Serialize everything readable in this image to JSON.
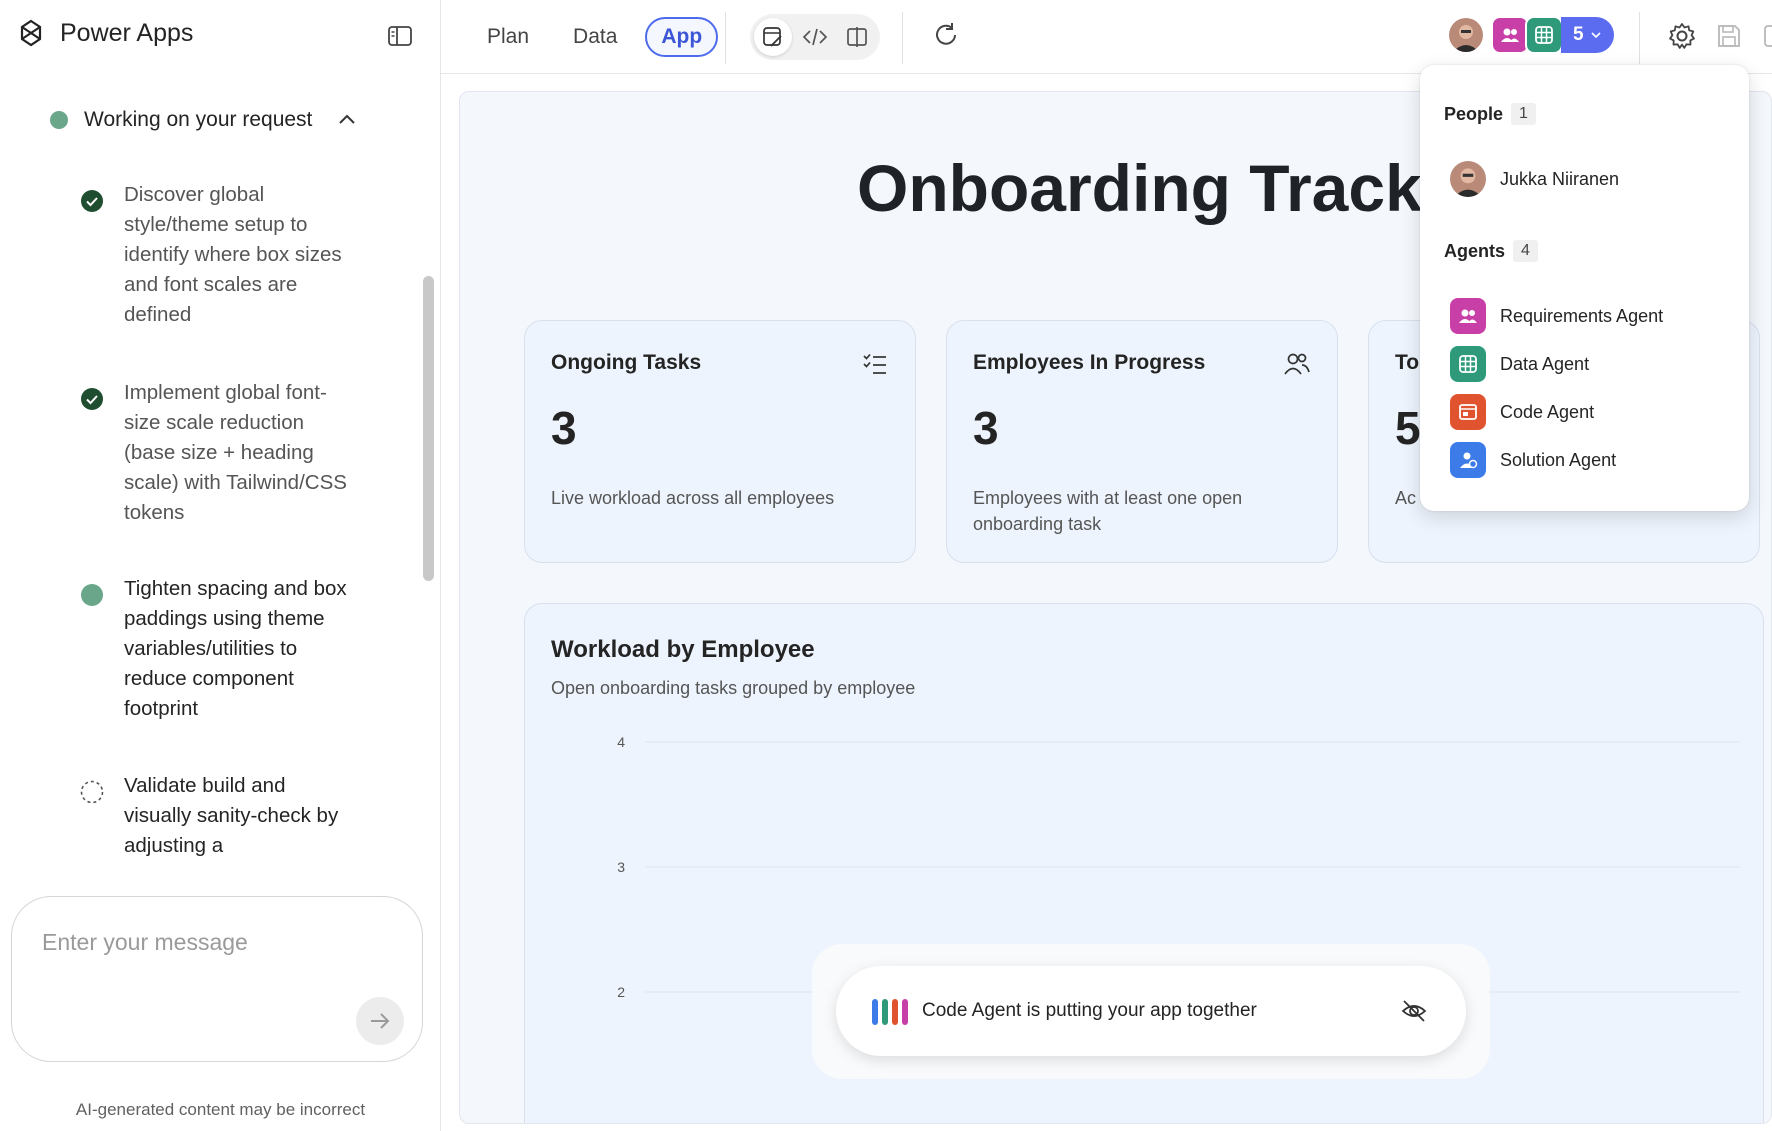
{
  "app": {
    "name": "Power Apps"
  },
  "left_panel": {
    "status_label": "Working on your request",
    "steps": [
      {
        "text": "Discover global style/theme setup to identify where box sizes and font scales are defined",
        "state": "done"
      },
      {
        "text": "Implement global font-size scale reduction (base size + heading scale) with Tailwind/CSS tokens",
        "state": "done"
      },
      {
        "text": "Tighten spacing and box paddings using theme variables/utilities to reduce component footprint",
        "state": "in-progress"
      },
      {
        "text": "Validate build and visually sanity-check by adjusting a",
        "state": "pending"
      }
    ],
    "composer_placeholder": "Enter your message",
    "disclaimer": "AI-generated content may be incorrect"
  },
  "topbar": {
    "tabs": [
      {
        "label": "Plan",
        "selected": false
      },
      {
        "label": "Data",
        "selected": false
      },
      {
        "label": "App",
        "selected": true
      }
    ],
    "collaborator_count": "5"
  },
  "canvas": {
    "title": "Onboarding Tracker",
    "cards": [
      {
        "title": "Ongoing Tasks",
        "value": "3",
        "description": "Live workload across all employees",
        "icon": "task-list-icon"
      },
      {
        "title": "Employees In Progress",
        "value": "3",
        "description": "Employees with at least one open onboarding task",
        "icon": "people-icon"
      },
      {
        "title": "To",
        "value": "5",
        "description": "Ac",
        "icon": ""
      }
    ],
    "chart_title": "Workload by Employee",
    "chart_subtitle": "Open onboarding tasks grouped by employee"
  },
  "chart_data": {
    "type": "bar",
    "title": "Workload by Employee",
    "subtitle": "Open onboarding tasks grouped by employee",
    "y_ticks": [
      4,
      3,
      2
    ],
    "grid": true
  },
  "popover": {
    "people_heading": "People",
    "people_count": "1",
    "people": [
      {
        "name": "Jukka Niiranen"
      }
    ],
    "agents_heading": "Agents",
    "agents_count": "4",
    "agents": [
      {
        "name": "Requirements Agent",
        "icon": "requirements-agent-icon",
        "color": "#c83fa8"
      },
      {
        "name": "Data Agent",
        "icon": "data-agent-icon",
        "color": "#2f9a7a"
      },
      {
        "name": "Code Agent",
        "icon": "code-agent-icon",
        "color": "#e0532f"
      },
      {
        "name": "Solution Agent",
        "icon": "solution-agent-icon",
        "color": "#3d7be8"
      }
    ]
  },
  "toast": {
    "text": "Code Agent is putting your app together"
  },
  "colors": {
    "accent": "#4f6bed",
    "status_done": "#1f4d2f",
    "status_active": "#6aa78a"
  }
}
